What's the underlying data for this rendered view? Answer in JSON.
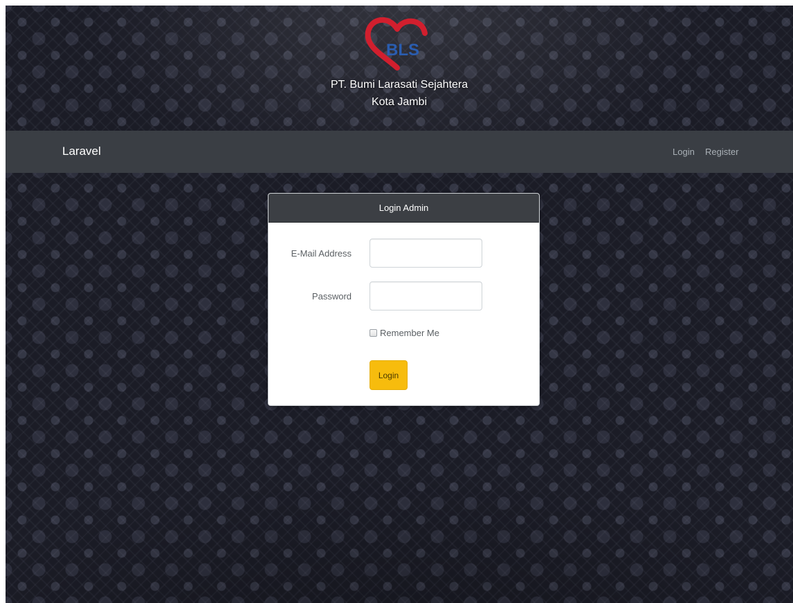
{
  "header": {
    "logo_text": "BLS",
    "company_name": "PT. Bumi Larasati Sejahtera",
    "company_city": "Kota Jambi"
  },
  "navbar": {
    "brand": "Laravel",
    "links": [
      {
        "label": "Login"
      },
      {
        "label": "Register"
      }
    ]
  },
  "login_panel": {
    "title": "Login Admin",
    "email": {
      "label": "E-Mail Address",
      "value": "",
      "placeholder": ""
    },
    "password": {
      "label": "Password",
      "value": "",
      "placeholder": ""
    },
    "remember": {
      "label": "Remember Me",
      "checked": false
    },
    "submit_label": "Login"
  },
  "colors": {
    "navbar_bg": "#3a3e44",
    "panel_heading_bg": "#3c3f44",
    "button_accent": "#f7bc0d",
    "logo_heart": "#d11f2e",
    "logo_text": "#2a5db0",
    "page_bg": "#1b1c26"
  },
  "icons": [
    "heart-logo-icon",
    "checkbox-icon"
  ]
}
